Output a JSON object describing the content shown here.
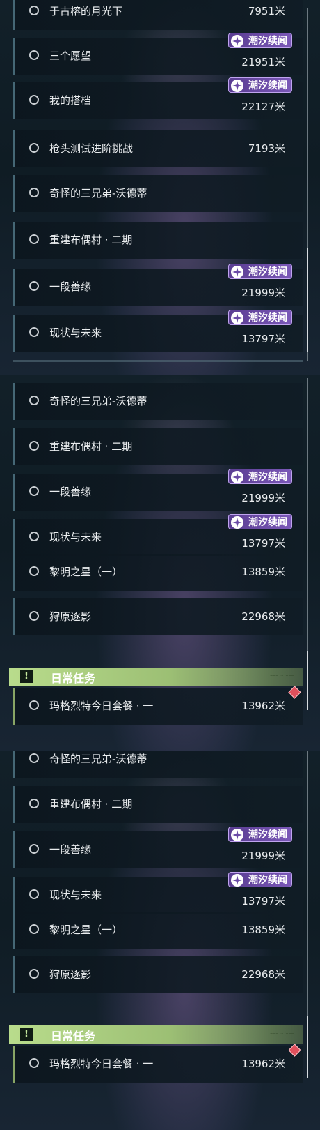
{
  "badge_label": "潮汐续闻",
  "daily_section_title": "日常任务",
  "panel1": {
    "quests": [
      {
        "title": "于古榕的月光下",
        "distance": "7951米",
        "badge": false
      },
      {
        "title": "三个愿望",
        "distance": "21951米",
        "badge": true
      },
      {
        "title": "我的搭档",
        "distance": "22127米",
        "badge": true
      },
      {
        "title": "枪头测试进阶挑战",
        "distance": "7193米",
        "badge": false
      },
      {
        "title": "奇怪的三兄弟-沃德蒂",
        "distance": "",
        "badge": false
      },
      {
        "title": "重建布偶村 · 二期",
        "distance": "",
        "badge": false
      },
      {
        "title": "一段善缘",
        "distance": "21999米",
        "badge": true
      },
      {
        "title": "现状与未来",
        "distance": "13797米",
        "badge": true
      }
    ]
  },
  "panel2": {
    "quests": [
      {
        "title": "奇怪的三兄弟-沃德蒂",
        "distance": "",
        "badge": false
      },
      {
        "title": "重建布偶村 · 二期",
        "distance": "",
        "badge": false
      },
      {
        "title": "一段善缘",
        "distance": "21999米",
        "badge": true
      },
      {
        "title": "现状与未来",
        "distance": "13797米",
        "badge": true
      },
      {
        "title": "黎明之星（一）",
        "distance": "13859米",
        "badge": false
      },
      {
        "title": "狩原逐影",
        "distance": "22968米",
        "badge": false
      }
    ],
    "daily": [
      {
        "title": "玛格烈特今日套餐 · 一",
        "distance": "13962米"
      }
    ]
  },
  "panel3": {
    "quests": [
      {
        "title": "奇怪的三兄弟-沃德蒂",
        "distance": "",
        "badge": false
      },
      {
        "title": "重建布偶村 · 二期",
        "distance": "",
        "badge": false
      },
      {
        "title": "一段善缘",
        "distance": "21999米",
        "badge": true
      },
      {
        "title": "现状与未来",
        "distance": "13797米",
        "badge": true
      },
      {
        "title": "黎明之星（一）",
        "distance": "13859米",
        "badge": false
      },
      {
        "title": "狩原逐影",
        "distance": "22968米",
        "badge": false
      }
    ],
    "daily": [
      {
        "title": "玛格烈特今日套餐 · 一",
        "distance": "13962米"
      }
    ]
  },
  "colors": {
    "badge_purple": "#6a4aa6",
    "daily_green": "#b9dc8c",
    "quest_row_bg": "#0f1c24",
    "daily_marker_red": "#e0505c"
  }
}
